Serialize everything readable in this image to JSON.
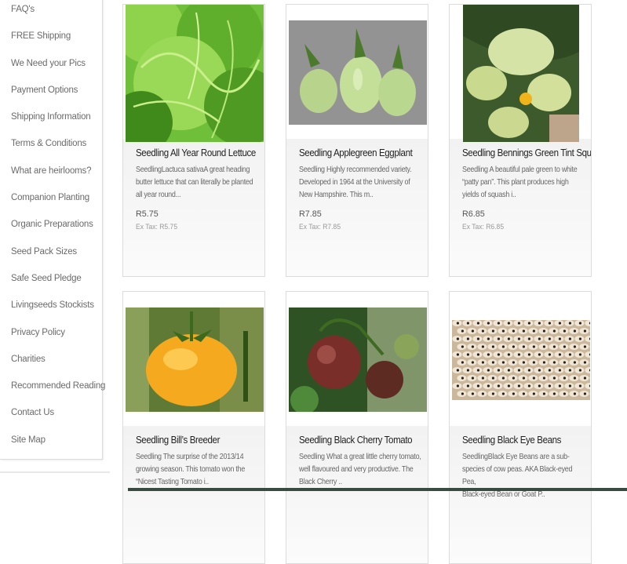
{
  "sidebar": {
    "items": [
      {
        "label": "FAQ's"
      },
      {
        "label": "FREE Shipping"
      },
      {
        "label": "We Need your Pics"
      },
      {
        "label": "Payment Options"
      },
      {
        "label": "Shipping Information"
      },
      {
        "label": "Terms & Conditions"
      },
      {
        "label": "What are heirlooms?"
      },
      {
        "label": "Companion Planting"
      },
      {
        "label": "Organic Preparations"
      },
      {
        "label": "Seed Pack Sizes"
      },
      {
        "label": "Safe Seed Pledge"
      },
      {
        "label": "Livingseeds Stockists"
      },
      {
        "label": "Privacy Policy"
      },
      {
        "label": "Charities"
      },
      {
        "label": "Recommended Reading"
      },
      {
        "label": "Contact Us"
      },
      {
        "label": "Site Map"
      }
    ]
  },
  "products": [
    {
      "name": "Seedling All Year Round Lettuce",
      "desc": [
        "SeedlingLactuca sativaA great heading",
        "butter lettuce that can literally be planted",
        "all year round..."
      ],
      "price": "R5.75",
      "extax": "Ex Tax: R5.75"
    },
    {
      "name": "Seedling Applegreen Eggplant",
      "desc": [
        "Seedling Highly recommended variety.",
        "Developed in 1964 at the University of",
        "New Hampshire. This m.."
      ],
      "price": "R7.85",
      "extax": "Ex Tax: R7.85"
    },
    {
      "name": "Seedling Bennings Green Tint Squash",
      "desc": [
        "Seedling A beautiful pale green to white",
        "“patty pan”. This plant produces high",
        "yields of squash i.."
      ],
      "price": "R6.85",
      "extax": "Ex Tax: R6.85"
    },
    {
      "name": "Seedling Bill’s Breeder",
      "desc": [
        "Seedling The surprise of the 2013/14",
        "growing season. This tomato won the",
        "“Nicest Tasting Tomato i.."
      ]
    },
    {
      "name": "Seedling Black Cherry Tomato",
      "desc": [
        "Seedling What a great little cherry tomato,",
        "well flavoured and very productive. The",
        "Black Cherry .."
      ]
    },
    {
      "name": "Seedling Black Eye Beans",
      "desc": [
        "SeedlingBlack Eye Beans are a sub-",
        "species of cow peas. AKA Black-eyed Pea,",
        "Black-eyed Bean or Goat P.."
      ]
    }
  ],
  "icons": {
    "p0": "lettuce-photo",
    "p1": "eggplant-photo",
    "p2": "squash-photo",
    "p3": "yellow-tomato-photo",
    "p4": "cherry-tomato-photo",
    "p5": "beans-photo"
  }
}
